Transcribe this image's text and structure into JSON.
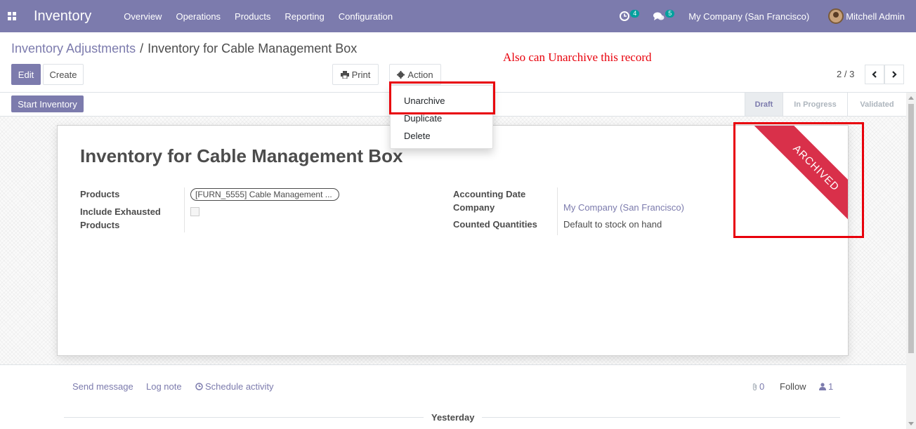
{
  "navbar": {
    "app_title": "Inventory",
    "menu": [
      "Overview",
      "Operations",
      "Products",
      "Reporting",
      "Configuration"
    ],
    "activity_count": "4",
    "message_count": "5",
    "company": "My Company (San Francisco)",
    "user": "Mitchell Admin"
  },
  "breadcrumb": {
    "parent": "Inventory Adjustments",
    "separator": "/",
    "current": "Inventory for Cable Management Box"
  },
  "toolbar": {
    "edit_label": "Edit",
    "create_label": "Create",
    "print_label": "Print",
    "action_label": "Action"
  },
  "action_menu": {
    "items": [
      "Unarchive",
      "Duplicate",
      "Delete"
    ]
  },
  "annotation": "Also can Unarchive this record",
  "pager": {
    "value": "2 / 3"
  },
  "statusbar": {
    "start_button": "Start Inventory",
    "stages": [
      "Draft",
      "In Progress",
      "Validated"
    ],
    "current_stage": "Draft"
  },
  "record": {
    "title": "Inventory for Cable Management Box",
    "products_label": "Products",
    "products_value": "[FURN_5555] Cable Management ...",
    "include_exhausted_label": "Include Exhausted Products",
    "include_exhausted_checked": false,
    "accounting_date_label": "Accounting Date",
    "company_label": "Company",
    "company_value": "My Company (San Francisco)",
    "counted_label": "Counted Quantities",
    "counted_value": "Default to stock on hand",
    "ribbon": "ARCHIVED"
  },
  "chatter": {
    "send_message": "Send message",
    "log_note": "Log note",
    "schedule_activity": "Schedule activity",
    "attachments_count": "0",
    "follow": "Follow",
    "followers_count": "1",
    "date_separator": "Yesterday"
  },
  "colors": {
    "brand": "#7c7bad",
    "annotation": "#e8000b",
    "ribbon": "#d9304a",
    "badge": "#00a09d"
  }
}
